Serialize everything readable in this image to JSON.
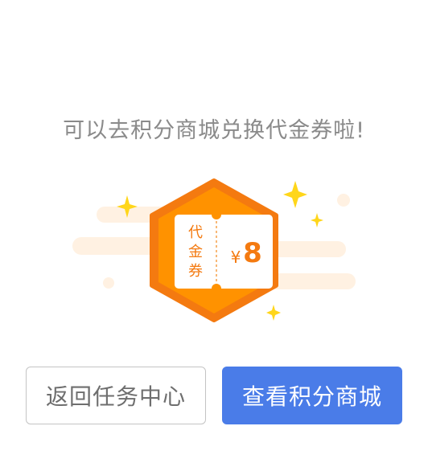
{
  "message": "可以去积分商城兑换代金券啦!",
  "coupon": {
    "type_chars": [
      "代",
      "金",
      "券"
    ],
    "currency": "¥",
    "amount": "8"
  },
  "buttons": {
    "back_label": "返回任务中心",
    "shop_label": "查看积分商城"
  },
  "colors": {
    "orange": "#f47a10",
    "blue_button": "#4a7ce8",
    "sparkle": "#ffd61a",
    "cloud": "#fff1e2"
  }
}
